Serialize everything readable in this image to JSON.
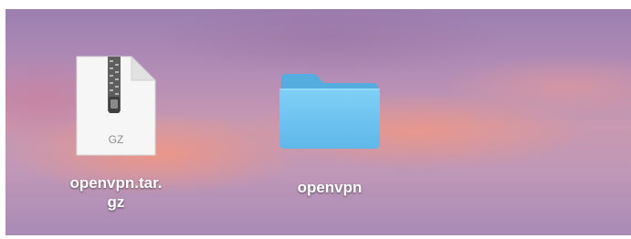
{
  "desktop": {
    "items": [
      {
        "label_line1": "openvpn.tar.",
        "label_line2": "gz",
        "icon": "gz-archive-icon",
        "badge": "GZ"
      },
      {
        "label": "openvpn",
        "icon": "folder-icon",
        "color": "#6cc2f0"
      }
    ]
  }
}
